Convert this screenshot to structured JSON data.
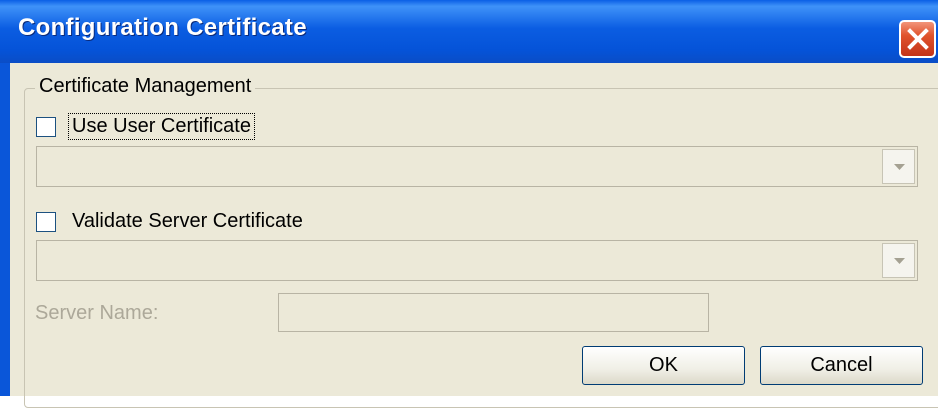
{
  "window": {
    "title": "Configuration Certificate"
  },
  "group": {
    "title": "Certificate Management",
    "use_user_certificate": {
      "label": "Use User Certificate",
      "checked": false
    },
    "user_certificate_select": {
      "value": ""
    },
    "validate_server_certificate": {
      "label": "Validate Server Certificate",
      "checked": false
    },
    "server_certificate_select": {
      "value": ""
    },
    "server_name": {
      "label": "Server Name:",
      "value": ""
    }
  },
  "buttons": {
    "ok": "OK",
    "cancel": "Cancel"
  },
  "icons": {
    "close": "close-icon",
    "dropdown": "chevron-down-icon"
  },
  "colors": {
    "titlebar": "#0553d8",
    "close": "#e0532c",
    "client": "#ece9d8",
    "disabled_text": "#aca899"
  }
}
